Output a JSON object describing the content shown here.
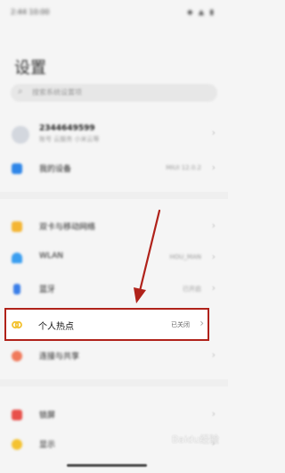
{
  "status_bar": {
    "time": "2:44 10:00",
    "icons": "◆ ▲ ▮"
  },
  "title": "设置",
  "search": {
    "placeholder": "搜索系统设置项"
  },
  "account": {
    "name": "2344649599",
    "subtitle": "账号 云服务 小米云等"
  },
  "items": [
    {
      "label": "我的设备",
      "value": "MIUI 12.0.2"
    },
    {
      "label": "双卡与移动网络",
      "value": ""
    },
    {
      "label": "WLAN",
      "value": "HOU_MAN"
    },
    {
      "label": "蓝牙",
      "value": "已开启"
    },
    {
      "label": "个人热点",
      "value": "已关闭"
    },
    {
      "label": "连接与共享",
      "value": ""
    },
    {
      "label": "锁屏",
      "value": ""
    },
    {
      "label": "显示",
      "value": ""
    }
  ],
  "colors": {
    "highlight_border": "#b0221a",
    "arrow": "#b0221a",
    "hotspot_icon": "#f3c12e"
  },
  "watermark": "Baidu经验"
}
